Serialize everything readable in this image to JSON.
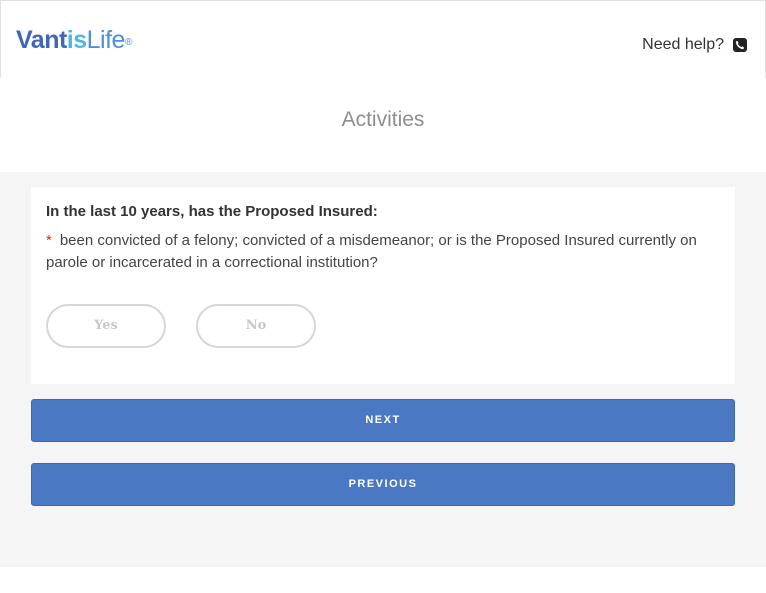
{
  "header": {
    "logo": {
      "brand": "Vant",
      "accent": "is",
      "life": "Life",
      "registered": "®"
    },
    "help_text": "Need help?",
    "help_icon": "phone-icon"
  },
  "page": {
    "title": "Activities"
  },
  "question": {
    "heading": "In the last 10 years, has the Proposed Insured:",
    "required_marker": "*",
    "text": "been convicted of a felony; convicted of a misdemeanor; or is the Proposed Insured currently on parole or incarcerated in a correctional institution?",
    "options": [
      "Yes",
      "No"
    ]
  },
  "buttons": {
    "next": "NEXT",
    "previous": "PREVIOUS"
  },
  "colors": {
    "primary_button": "#4a78c2",
    "logo_dark": "#3f66b8",
    "logo_light": "#4fb4e8",
    "required": "#d0312d"
  }
}
